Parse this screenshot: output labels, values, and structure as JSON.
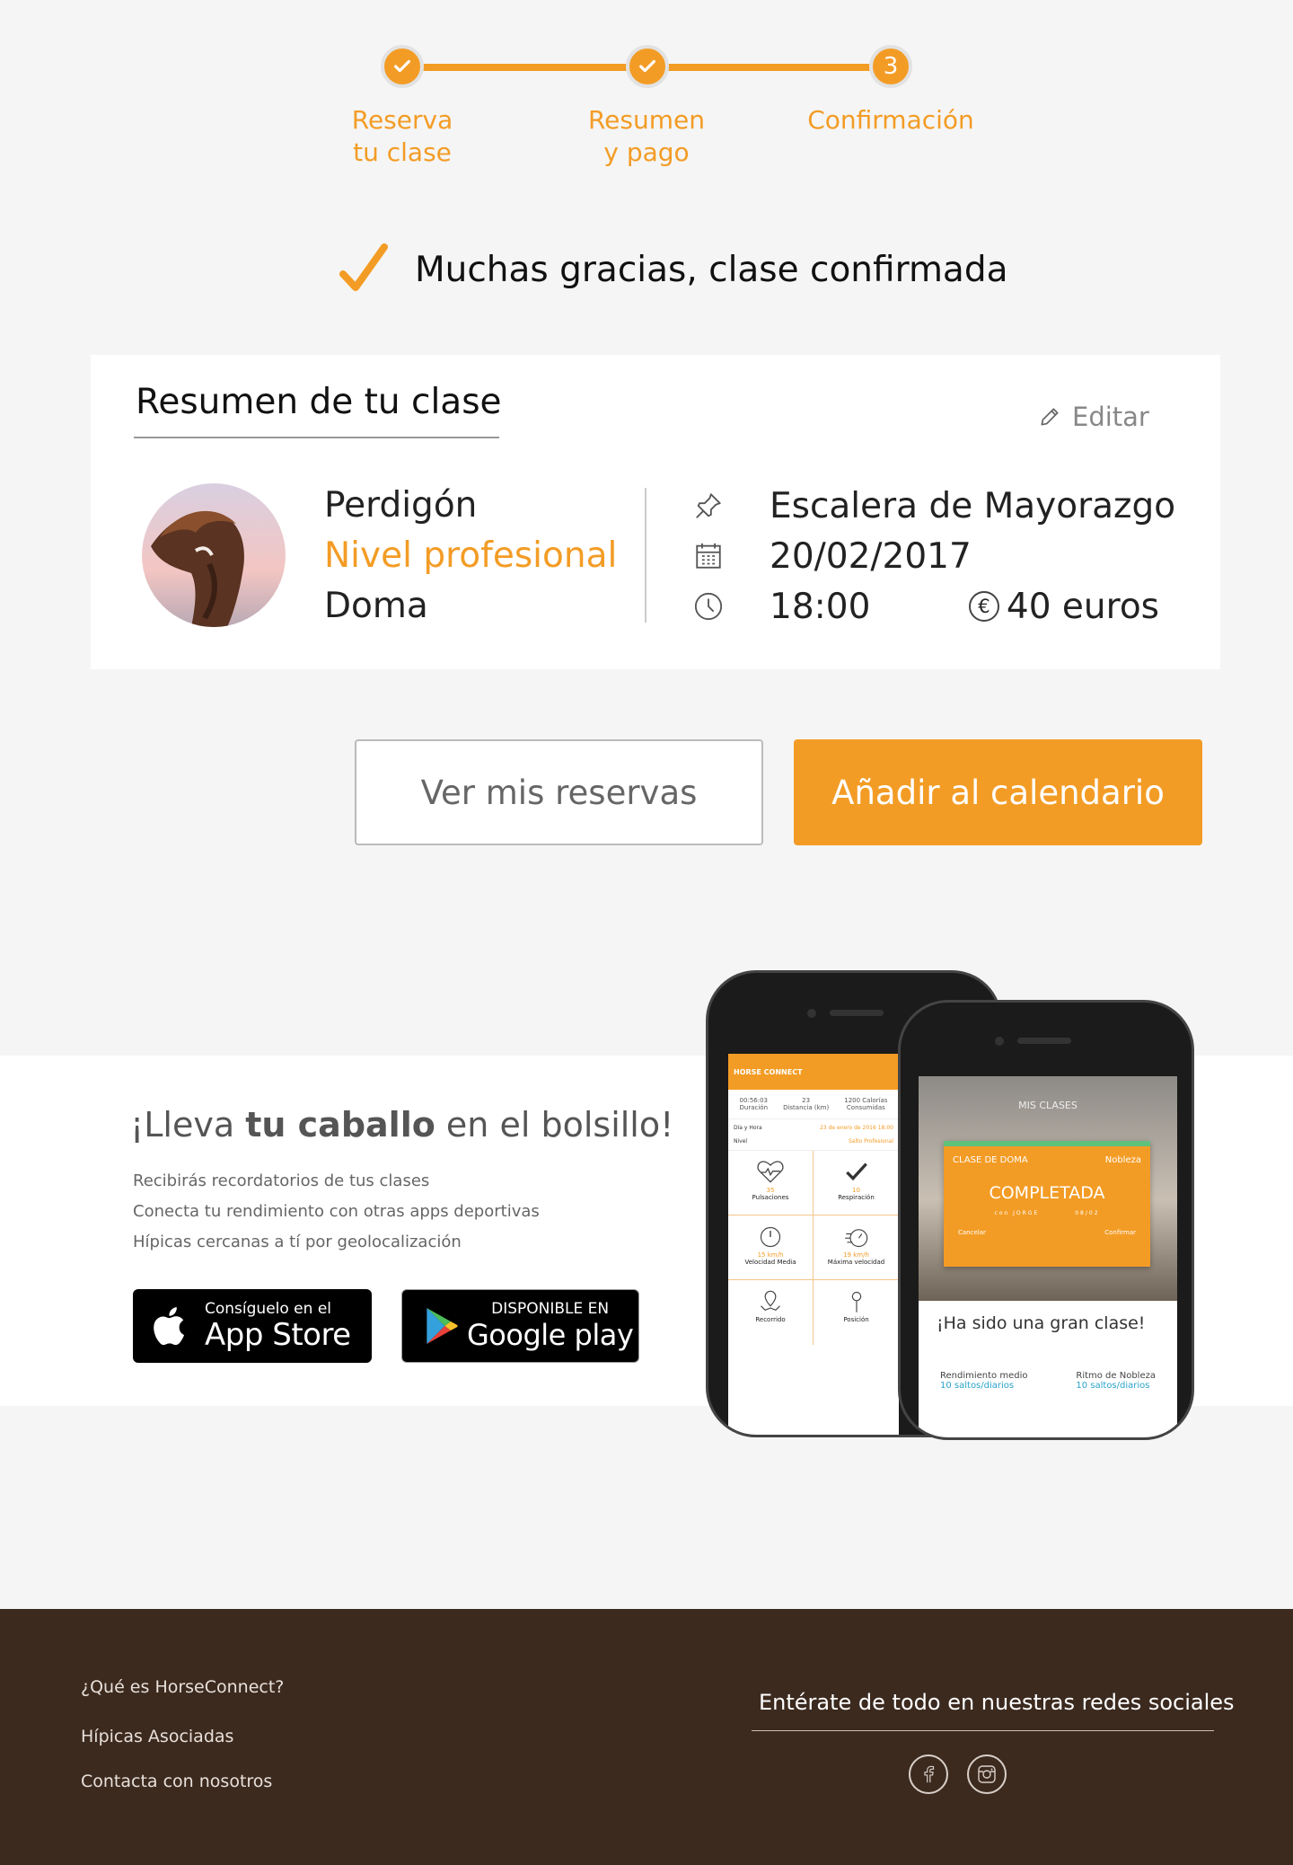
{
  "colors": {
    "accent": "#f39c25",
    "footer_bg": "#3c2a1f",
    "page_bg": "#f5f5f5"
  },
  "stepper": {
    "steps": [
      {
        "label_line1": "Reserva",
        "label_line2": "tu clase",
        "state": "done",
        "icon": "check-icon"
      },
      {
        "label_line1": "Resumen",
        "label_line2": "y pago",
        "state": "done",
        "icon": "check-icon"
      },
      {
        "label_line1": "Confirmación",
        "label_line2": "",
        "state": "current",
        "number": "3"
      }
    ]
  },
  "confirmation": {
    "text": "Muchas gracias, clase confirmada",
    "icon": "checkmark-icon"
  },
  "summary": {
    "title": "Resumen de tu clase",
    "edit_label": "Editar",
    "horse_name": "Perdigón",
    "level": "Nivel profesional",
    "discipline": "Doma",
    "location": "Escalera de Mayorazgo",
    "date": "20/02/2017",
    "time": "18:00",
    "price": "40 euros"
  },
  "actions": {
    "view_bookings": "Ver mis reservas",
    "add_calendar": "Añadir al calendario"
  },
  "promo": {
    "title_prefix": "¡Lleva ",
    "title_bold": "tu caballo",
    "title_suffix": " en el bolsillo!",
    "features": [
      "Recibirás recordatorios de tus clases",
      "Conecta tu rendimiento con otras apps deportivas",
      "Hípicas cercanas a tí por geolocalización"
    ],
    "appstore": {
      "top": "Consíguelo en el",
      "big": "App Store"
    },
    "googleplay": {
      "top": "DISPONIBLE EN",
      "big": "Google play"
    },
    "phone_back": {
      "brand": "HORSE CONNECT",
      "stats": [
        "00:56:03",
        "Duración",
        "23",
        "Distancia (km)",
        "1200 Calorías",
        "Consumidas"
      ],
      "row1_label": "Día y Hora",
      "row1_value": "23 de enero de 2016 18:00",
      "row2_label": "Nivel",
      "row2_value": "Salto Profesional",
      "tiles": [
        {
          "value": "35",
          "label": "Pulsaciones"
        },
        {
          "value": "10",
          "label": "Respiración"
        },
        {
          "value": "15 km/h",
          "label": "Velocidad Media"
        },
        {
          "value": "19 km/h",
          "label": "Máxima velocidad"
        },
        {
          "value": "",
          "label": "Recorrido"
        },
        {
          "value": "",
          "label": "Posición"
        }
      ]
    },
    "phone_front": {
      "header": "MIS CLASES",
      "card_type": "CLASE DE DOMA",
      "card_horse": "Nobleza",
      "card_status": "COMPLETADA",
      "card_with": "con JORGE",
      "card_date": "08/02",
      "cancel": "Cancelar",
      "confirm": "Confirmar",
      "message": "¡Ha sido una gran clase!",
      "stat1_label": "Rendimiento medio",
      "stat1_value": "10 saltos/diarios",
      "stat2_label": "Ritmo de Nobleza",
      "stat2_value": "10 saltos/diarios"
    }
  },
  "footer": {
    "links": [
      "¿Qué es HorseConnect?",
      "Hípicas Asociadas",
      "Contacta con nosotros"
    ],
    "social_title": "Entérate de todo en nuestras redes sociales",
    "social_icons": [
      "facebook-icon",
      "instagram-icon"
    ]
  }
}
